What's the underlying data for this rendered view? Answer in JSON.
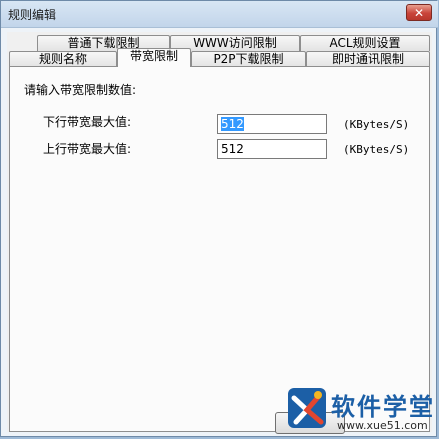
{
  "window": {
    "title": "规则编辑",
    "close_glyph": "✕"
  },
  "tabs": {
    "row1": [
      {
        "label": "普通下载限制"
      },
      {
        "label": "WWW访问限制"
      },
      {
        "label": "ACL规则设置"
      }
    ],
    "row2": [
      {
        "label": "规则名称"
      },
      {
        "label": "带宽限制",
        "active": true
      },
      {
        "label": "P2P下载限制"
      },
      {
        "label": "即时通讯限制"
      }
    ]
  },
  "bandwidth": {
    "prompt": "请输入带宽限制数值:",
    "download_label": "下行带宽最大值:",
    "download_value": "512",
    "download_unit": "(KBytes/S)",
    "upload_label": "上行带宽最大值:",
    "upload_value": "512",
    "upload_unit": "(KBytes/S)"
  },
  "watermark": {
    "name": "软件学堂",
    "url": "www.xue51.com"
  },
  "colors": {
    "accent": "#1c5fa6",
    "selection": "#3399ff",
    "close": "#c9443a"
  }
}
